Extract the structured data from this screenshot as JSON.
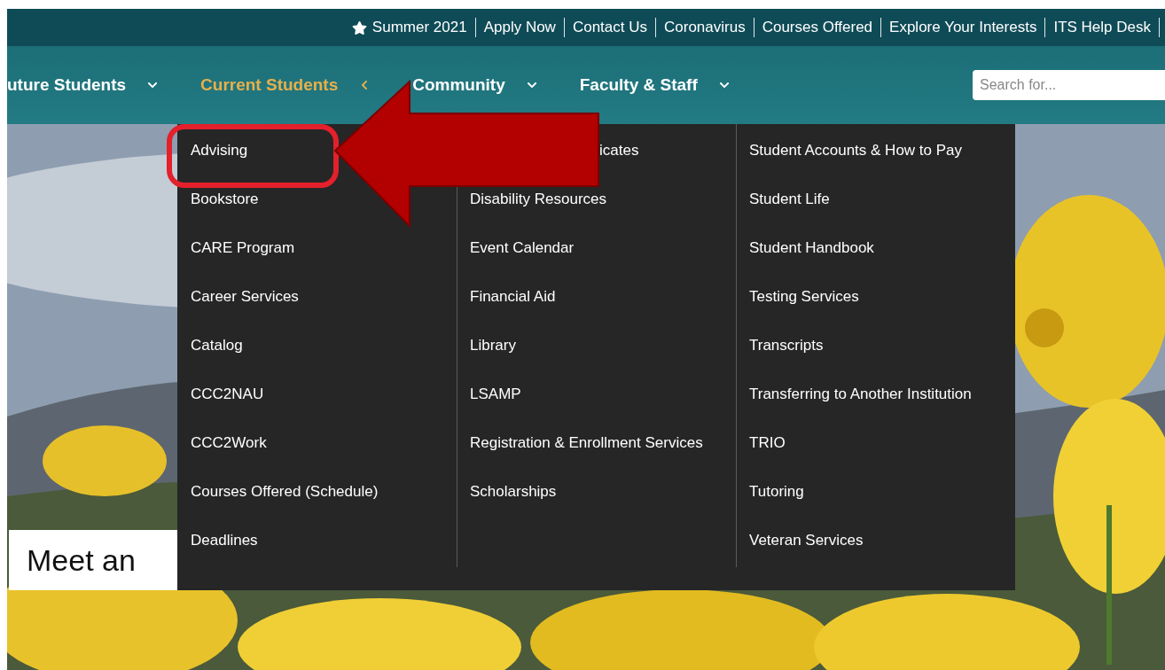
{
  "top_links": [
    {
      "label": "Summer 2021",
      "starred": true
    },
    {
      "label": "Apply Now",
      "starred": false
    },
    {
      "label": "Contact Us",
      "starred": false
    },
    {
      "label": "Coronavirus",
      "starred": false
    },
    {
      "label": "Courses Offered",
      "starred": false
    },
    {
      "label": "Explore Your Interests",
      "starred": false
    },
    {
      "label": "ITS Help Desk",
      "starred": false
    }
  ],
  "nav": {
    "items": [
      {
        "label": "uture Students",
        "selected": false
      },
      {
        "label": "Current Students",
        "selected": true
      },
      {
        "label": "Community",
        "selected": false
      },
      {
        "label": "Faculty & Staff",
        "selected": false
      }
    ],
    "search": {
      "placeholder": "Search for..."
    }
  },
  "mega_menu": {
    "columns": [
      [
        {
          "label": "Advising",
          "kind": "link"
        },
        {
          "label": "Bookstore",
          "kind": "link"
        },
        {
          "label": "CARE Program",
          "kind": "link"
        },
        {
          "label": "Career Services",
          "kind": "link"
        },
        {
          "label": "Catalog",
          "kind": "link"
        },
        {
          "label": "CCC2NAU",
          "kind": "link"
        },
        {
          "label": "CCC2Work",
          "kind": "link"
        },
        {
          "label": "Courses Offered (Schedule)",
          "kind": "link"
        },
        {
          "label": "Deadlines",
          "kind": "link"
        }
      ],
      [
        {
          "label": "icates",
          "kind": "covered"
        },
        {
          "label": "Disability Resources",
          "kind": "link"
        },
        {
          "label": "Event Calendar",
          "kind": "link"
        },
        {
          "label": "Financial Aid",
          "kind": "link"
        },
        {
          "label": "Library",
          "kind": "link"
        },
        {
          "label": "LSAMP",
          "kind": "link"
        },
        {
          "label": "Registration & Enrollment Services",
          "kind": "link"
        },
        {
          "label": "Scholarships",
          "kind": "link"
        }
      ],
      [
        {
          "label": "Student Accounts & How to Pay",
          "kind": "link"
        },
        {
          "label": "Student Life",
          "kind": "link"
        },
        {
          "label": "Student Handbook",
          "kind": "link"
        },
        {
          "label": "Testing Services",
          "kind": "link"
        },
        {
          "label": "Transcripts",
          "kind": "link"
        },
        {
          "label": "Transferring to Another Institution",
          "kind": "link"
        },
        {
          "label": "TRIO",
          "kind": "link"
        },
        {
          "label": "Tutoring",
          "kind": "link"
        },
        {
          "label": "Veteran Services",
          "kind": "link"
        }
      ]
    ]
  },
  "hero": {
    "caption": "Meet an"
  }
}
